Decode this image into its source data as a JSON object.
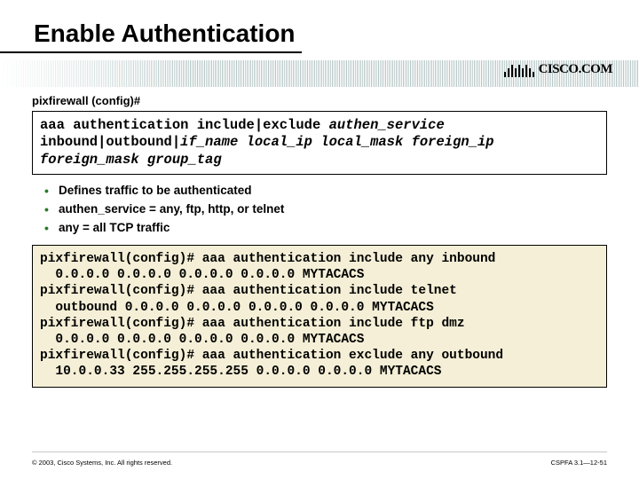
{
  "title": "Enable Authentication",
  "logo_text": "CISCO.COM",
  "prompt": "pixfirewall (config)#",
  "syntax": {
    "line1_cmd": "aaa authentication include|exclude ",
    "line1_arg": "authen_service",
    "line2_pre": "  inbound|outbound|",
    "line2_args": "if_name local_ip local_mask foreign_ip",
    "line3_args": "  foreign_mask group_tag"
  },
  "bullets": [
    "Defines traffic to be authenticated",
    "authen_service = any, ftp, http, or telnet",
    "any = all TCP traffic"
  ],
  "example": "pixfirewall(config)# aaa authentication include any inbound\n  0.0.0.0 0.0.0.0 0.0.0.0 0.0.0.0 MYTACACS\npixfirewall(config)# aaa authentication include telnet\n  outbound 0.0.0.0 0.0.0.0 0.0.0.0 0.0.0.0 MYTACACS\npixfirewall(config)# aaa authentication include ftp dmz\n  0.0.0.0 0.0.0.0 0.0.0.0 0.0.0.0 MYTACACS\npixfirewall(config)# aaa authentication exclude any outbound\n  10.0.0.33 255.255.255.255 0.0.0.0 0.0.0.0 MYTACACS",
  "footer_left": "© 2003, Cisco Systems, Inc. All rights reserved.",
  "footer_right": "CSPFA 3.1—12-51"
}
